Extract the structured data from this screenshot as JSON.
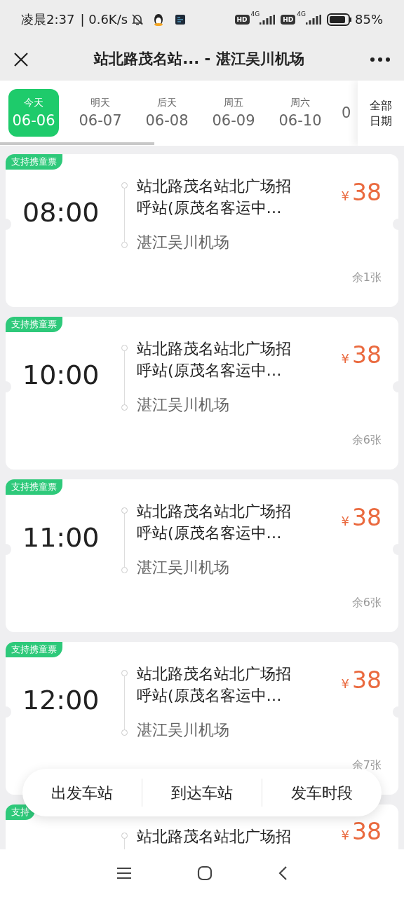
{
  "status_bar": {
    "time": "凌晨2:37",
    "speed": "| 0.6K/s",
    "sim1_badge": "HD",
    "sim1_net": "4G",
    "sim2_badge": "HD",
    "sim2_net": "4G",
    "battery": "85%"
  },
  "header": {
    "title": "站北路茂名站... - 湛江吴川机场"
  },
  "dates": [
    {
      "weekday": "今天",
      "date": "06-06",
      "selected": true
    },
    {
      "weekday": "明天",
      "date": "06-07",
      "selected": false
    },
    {
      "weekday": "后天",
      "date": "06-08",
      "selected": false
    },
    {
      "weekday": "周五",
      "date": "06-09",
      "selected": false
    },
    {
      "weekday": "周六",
      "date": "06-10",
      "selected": false
    },
    {
      "date": "0",
      "selected": false
    }
  ],
  "all_dates": "全部日期",
  "trips": [
    {
      "tag": "支持携童票",
      "time": "08:00",
      "origin": "站北路茂名站北广场招呼站(原茂名客运中…",
      "destination": "湛江吴川机场",
      "currency": "¥",
      "price": "38",
      "remaining": "余1张"
    },
    {
      "tag": "支持携童票",
      "time": "10:00",
      "origin": "站北路茂名站北广场招呼站(原茂名客运中…",
      "destination": "湛江吴川机场",
      "currency": "¥",
      "price": "38",
      "remaining": "余6张"
    },
    {
      "tag": "支持携童票",
      "time": "11:00",
      "origin": "站北路茂名站北广场招呼站(原茂名客运中…",
      "destination": "湛江吴川机场",
      "currency": "¥",
      "price": "38",
      "remaining": "余6张"
    },
    {
      "tag": "支持携童票",
      "time": "12:00",
      "origin": "站北路茂名站北广场招呼站(原茂名客运中…",
      "destination": "湛江吴川机场",
      "currency": "¥",
      "price": "38",
      "remaining": "余7张"
    },
    {
      "tag": "支持",
      "origin": "站北路茂名站北广场招",
      "currency": "¥",
      "price": "38"
    }
  ],
  "filters": [
    "出发车站",
    "到达车站",
    "发车时段"
  ]
}
